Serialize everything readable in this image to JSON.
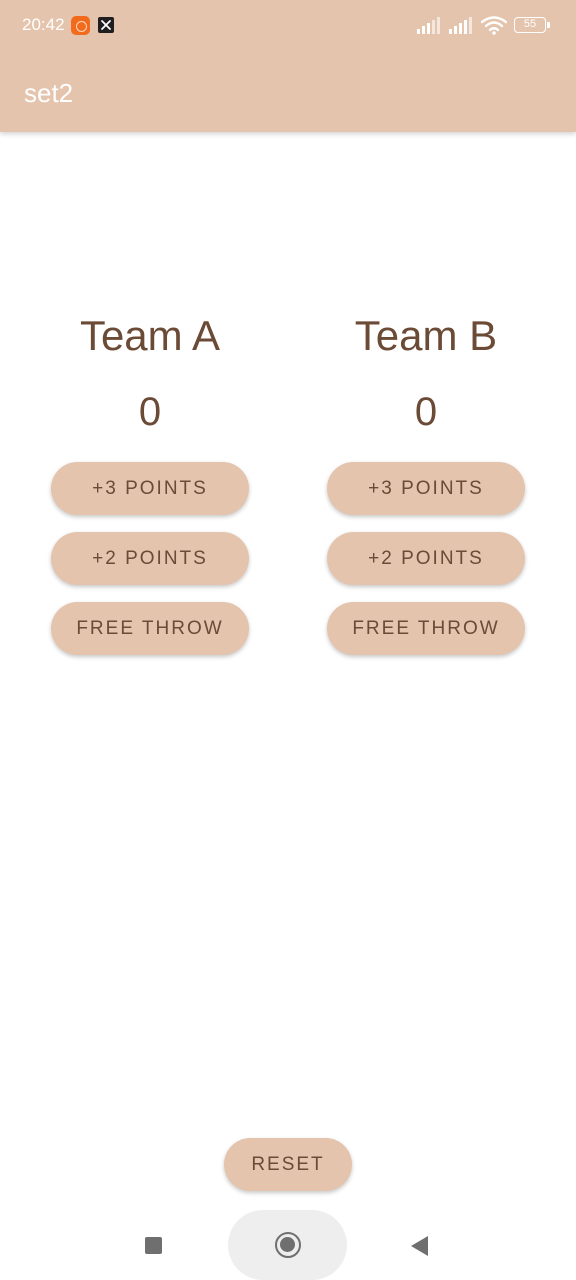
{
  "status_bar": {
    "time": "20:42",
    "battery": "55",
    "icons": [
      "app-notification-icon",
      "tool-notification-icon",
      "signal-icon",
      "signal-icon",
      "wifi-icon",
      "battery-icon"
    ]
  },
  "app_bar": {
    "title": "set2"
  },
  "team_a": {
    "name": "Team A",
    "score": "0",
    "buttons": {
      "three": "+3 POINTS",
      "two": "+2 POINTS",
      "free": "FREE THROW"
    }
  },
  "team_b": {
    "name": "Team B",
    "score": "0",
    "buttons": {
      "three": "+3 POINTS",
      "two": "+2 POINTS",
      "free": "FREE THROW"
    }
  },
  "reset": {
    "label": "RESET"
  },
  "nav_bar": {
    "icons": [
      "recents-icon",
      "home-icon",
      "back-icon"
    ]
  },
  "colors": {
    "accent": "#e4c4ad",
    "text": "#6b4a36",
    "background": "#ffffff"
  }
}
